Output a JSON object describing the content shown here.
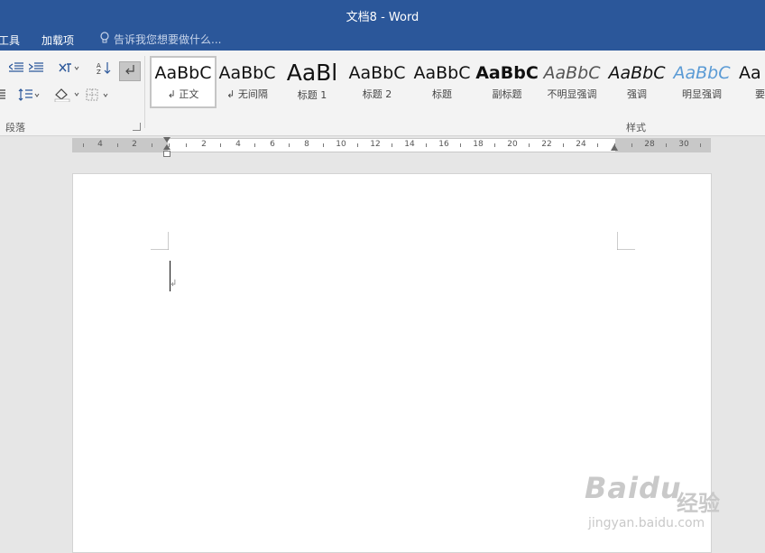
{
  "window": {
    "title": "文档8 - Word"
  },
  "tabs": {
    "partial": "工具",
    "addins": "加载项"
  },
  "tell_me": {
    "placeholder": "告诉我您想要做什么..."
  },
  "ribbon": {
    "paragraph_group": "段落",
    "styles_group": "样式",
    "styles": [
      {
        "preview": "AaBbC",
        "label": "↲ 正文"
      },
      {
        "preview": "AaBbC",
        "label": "↲ 无间隔"
      },
      {
        "preview": "AaBl",
        "label": "标题 1"
      },
      {
        "preview": "AaBbC",
        "label": "标题 2"
      },
      {
        "preview": "AaBbC",
        "label": "标题"
      },
      {
        "preview": "AaBbC",
        "label": "副标题"
      },
      {
        "preview": "AaBbC",
        "label": "不明显强调"
      },
      {
        "preview": "AaBbC",
        "label": "强调"
      },
      {
        "preview": "AaBbC",
        "label": "明显强调"
      },
      {
        "preview": "Aa",
        "label": "要"
      }
    ]
  },
  "ruler": {
    "labels": [
      "4",
      "2",
      "2",
      "4",
      "6",
      "8",
      "10",
      "12",
      "14",
      "16",
      "18",
      "20",
      "22",
      "24",
      "28",
      "30"
    ]
  },
  "document": {
    "paragraph_mark": "↲"
  },
  "watermark": {
    "brand": "Baidu",
    "cn": "经验",
    "url": "jingyan.baidu.com"
  },
  "colors": {
    "title_bar": "#2b579a",
    "accent_emphasis": "#5b9bd5"
  }
}
